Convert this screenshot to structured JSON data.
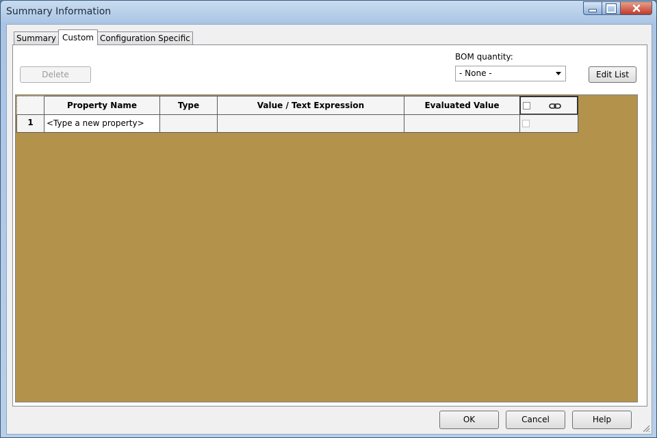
{
  "window": {
    "title": "Summary Information"
  },
  "tabs": [
    {
      "label": "Summary"
    },
    {
      "label": "Custom"
    },
    {
      "label": "Configuration Specific"
    }
  ],
  "toolbar": {
    "delete_label": "Delete",
    "edit_list_label": "Edit List"
  },
  "bom": {
    "label": "BOM quantity:",
    "value": "- None -"
  },
  "table": {
    "columns": [
      "Property Name",
      "Type",
      "Value / Text Expression",
      "Evaluated Value"
    ],
    "rows": [
      {
        "number": "1",
        "property_name": "<Type a new property>",
        "type": "",
        "value": "",
        "evaluated": ""
      }
    ]
  },
  "footer": {
    "ok_label": "OK",
    "cancel_label": "Cancel",
    "help_label": "Help"
  },
  "colors": {
    "grid_background": "#b3924b"
  },
  "icons": {
    "link": "chain-link-icon",
    "close": "close-icon",
    "maximize": "maximize-icon",
    "minimize": "minimize-icon"
  }
}
